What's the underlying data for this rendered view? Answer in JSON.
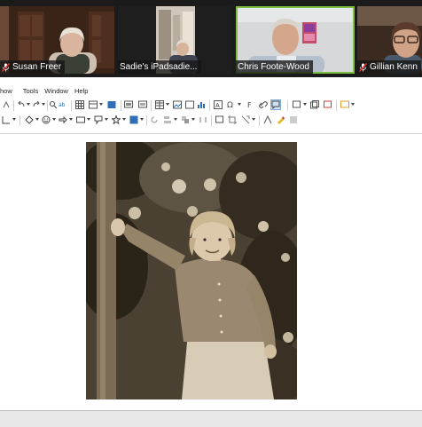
{
  "participants": [
    {
      "name": "Susan Freer",
      "muted": true
    },
    {
      "name": "Sadie's iPadsadie...",
      "muted": false
    },
    {
      "name": "Chris Foote-Wood",
      "muted": false,
      "active_speaker": true
    },
    {
      "name": "Gillian Kenn",
      "muted": true
    }
  ],
  "menu": {
    "items": [
      "how",
      "Tools",
      "Window",
      "Help"
    ]
  },
  "colors": {
    "active_speaker_border": "#7fbf3f",
    "muted_icon": "#e0322c",
    "toolbar_icon_blue": "#2f6fb5",
    "toolbar_icon_red": "#d33c2f"
  }
}
